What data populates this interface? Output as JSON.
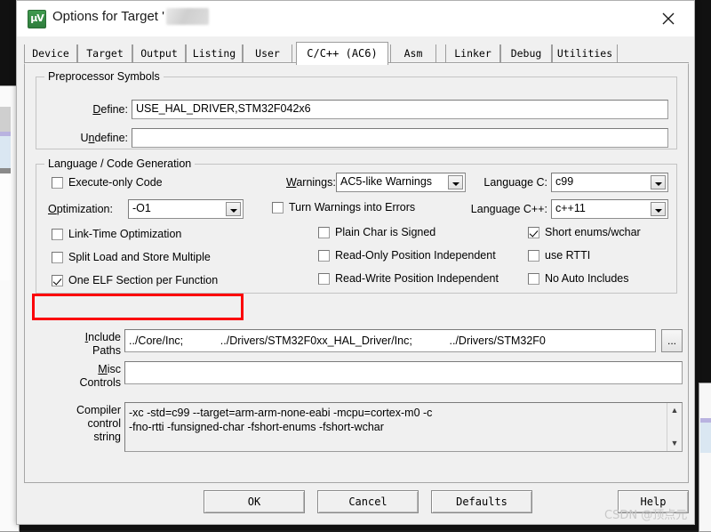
{
  "window": {
    "title": "Options for Target '",
    "title_suffix": "",
    "icon": "uvision-icon",
    "icon_glyph": "µV",
    "close_label": "✕"
  },
  "tabs": [
    {
      "label": "Device",
      "active": false
    },
    {
      "label": "Target",
      "active": false
    },
    {
      "label": "Output",
      "active": false
    },
    {
      "label": "Listing",
      "active": false
    },
    {
      "label": "User",
      "active": false
    },
    {
      "label": "C/C++ (AC6)",
      "active": true
    },
    {
      "label": "Asm",
      "active": false
    },
    {
      "label": "Linker",
      "active": false
    },
    {
      "label": "Debug",
      "active": false
    },
    {
      "label": "Utilities",
      "active": false
    }
  ],
  "preprocessor": {
    "legend": "Preprocessor Symbols",
    "define_label": "Define:",
    "define_value": "USE_HAL_DRIVER,STM32F042x6",
    "undefine_label": "Undefine:",
    "undefine_value": ""
  },
  "language": {
    "legend": "Language / Code Generation",
    "execute_only_label": "Execute-only Code",
    "execute_only_checked": false,
    "optimization_label": "Optimization:",
    "optimization_value": "-O1",
    "lto_label": "Link-Time Optimization",
    "lto_checked": false,
    "split_label": "Split Load and Store Multiple",
    "split_checked": false,
    "one_elf_label": "One ELF Section per Function",
    "one_elf_checked": true,
    "warnings_label": "Warnings:",
    "warnings_value": "AC5-like Warnings",
    "turn_warnings_label": "Turn Warnings into Errors",
    "turn_warnings_checked": false,
    "plain_char_label": "Plain Char is Signed",
    "plain_char_checked": false,
    "ropi_label": "Read-Only Position Independent",
    "ropi_checked": false,
    "rwpi_label": "Read-Write Position Independent",
    "rwpi_checked": false,
    "language_c_label": "Language C:",
    "language_c_value": "c99",
    "language_cpp_label": "Language C++:",
    "language_cpp_value": "c++11",
    "short_enums_label": "Short enums/wchar",
    "short_enums_checked": true,
    "use_rtti_label": "use RTTI",
    "use_rtti_checked": false,
    "no_auto_includes_label": "No Auto Includes",
    "no_auto_includes_checked": false
  },
  "paths": {
    "include_label_line1": "Include",
    "include_label_line2": "Paths",
    "include_value": "../Core/Inc;            ../Drivers/STM32F0xx_HAL_Driver/Inc;            ../Drivers/STM32F0",
    "browse_label": "...",
    "misc_label_line1": "Misc",
    "misc_label_line2": "Controls",
    "misc_value": ""
  },
  "compiler": {
    "label_line1": "Compiler",
    "label_line2": "control",
    "label_line3": "string",
    "value": "-xc -std=c99 --target=arm-arm-none-eabi -mcpu=cortex-m0 -c\n-fno-rtti -funsigned-char -fshort-enums -fshort-wchar",
    "scroll_up": "▲",
    "scroll_down": "▼"
  },
  "buttons": {
    "ok": "OK",
    "cancel": "Cancel",
    "defaults": "Defaults",
    "help": "Help"
  },
  "watermark": "CSDN @顶点元",
  "colors": {
    "accent_red": "#fb0007",
    "dialog_bg": "#f0f0f0",
    "field_bg": "#ffffff",
    "icon_green": "#2f7d3d"
  }
}
